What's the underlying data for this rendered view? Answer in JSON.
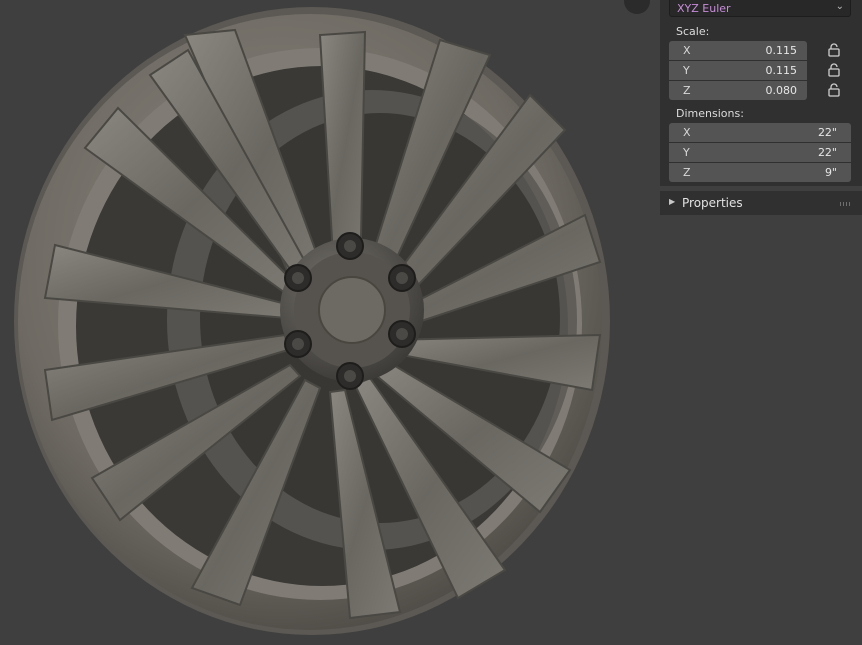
{
  "viewport": {
    "object": "wheel-rim",
    "icons": [
      "grid-icon"
    ]
  },
  "npanel": {
    "rotation_mode": "XYZ Euler",
    "scale": {
      "label": "Scale:",
      "x_label": "X",
      "x": "0.115",
      "y_label": "Y",
      "y": "0.115",
      "z_label": "Z",
      "z": "0.080"
    },
    "dimensions": {
      "label": "Dimensions:",
      "x_label": "X",
      "x": "22\"",
      "y_label": "Y",
      "y": "22\"",
      "z_label": "Z",
      "z": "9\""
    }
  },
  "properties_panel": {
    "title": "Properties"
  },
  "colors": {
    "background": "#3f3f3f",
    "panel": "#303030",
    "field": "#545454",
    "accent_text": "#c88cda"
  }
}
